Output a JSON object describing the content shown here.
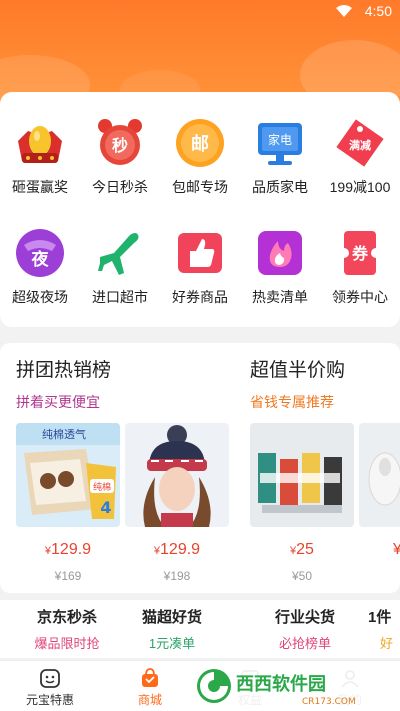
{
  "status_bar": {
    "time": "4:50"
  },
  "colors": {
    "accent": "#ff6a1a",
    "price": "#e8432e",
    "purple": "#b0378f",
    "orange_sub": "#f07a24",
    "pink_sub": "#e0457a",
    "green_sub": "#2fa36b"
  },
  "quick_grid": [
    {
      "label": "砸蛋赢奖",
      "icon": "golden-egg-icon"
    },
    {
      "label": "今日秒杀",
      "icon": "alarm-clock-icon",
      "glyph": "秒"
    },
    {
      "label": "包邮专场",
      "icon": "free-shipping-icon",
      "glyph": "邮"
    },
    {
      "label": "品质家电",
      "icon": "tv-appliance-icon",
      "glyph": "家电"
    },
    {
      "label": "199减100",
      "icon": "discount-tag-icon",
      "glyph": "满减"
    },
    {
      "label": "超级夜场",
      "icon": "night-mask-icon",
      "glyph": "夜"
    },
    {
      "label": "进口超市",
      "icon": "airplane-icon"
    },
    {
      "label": "好券商品",
      "icon": "thumbs-up-icon"
    },
    {
      "label": "热卖清单",
      "icon": "flame-icon"
    },
    {
      "label": "领券中心",
      "icon": "coupon-icon",
      "glyph": "券"
    }
  ],
  "promo_sections": [
    {
      "title": "拼团热销榜",
      "subtitle": "拼着买更便宜",
      "products": [
        {
          "price": "129.9",
          "currency": "¥",
          "orig": "¥169",
          "image": "kids-underwear-box",
          "img_text": "纯棉透气",
          "badge": "纯棉",
          "badge_num": "4"
        },
        {
          "price": "129.9",
          "currency": "¥",
          "orig": "¥198",
          "image": "knit-hat-woman"
        }
      ]
    },
    {
      "title": "超值半价购",
      "subtitle": "省钱专属推荐",
      "products": [
        {
          "price": "25",
          "currency": "¥",
          "orig": "¥50",
          "image": "colorful-socks"
        },
        {
          "image": "white-shoes"
        }
      ]
    }
  ],
  "categories": [
    {
      "title": "京东秒杀",
      "sub": "爆品限时抢"
    },
    {
      "title": "猫超好货",
      "sub": "1元凑单"
    },
    {
      "title": "行业尖货",
      "sub": "必抢榜单"
    },
    {
      "title": "1件",
      "sub": "好"
    }
  ],
  "tabbar": [
    {
      "label": "元宝特惠",
      "icon": "smiley-face-icon"
    },
    {
      "label": "商城",
      "icon": "shopping-bag-icon"
    },
    {
      "label": "权益",
      "icon": "benefit-icon"
    },
    {
      "label": "我的",
      "icon": "user-icon"
    }
  ],
  "watermark": {
    "brand": "西西软件园",
    "domain": "CR173.COM"
  }
}
